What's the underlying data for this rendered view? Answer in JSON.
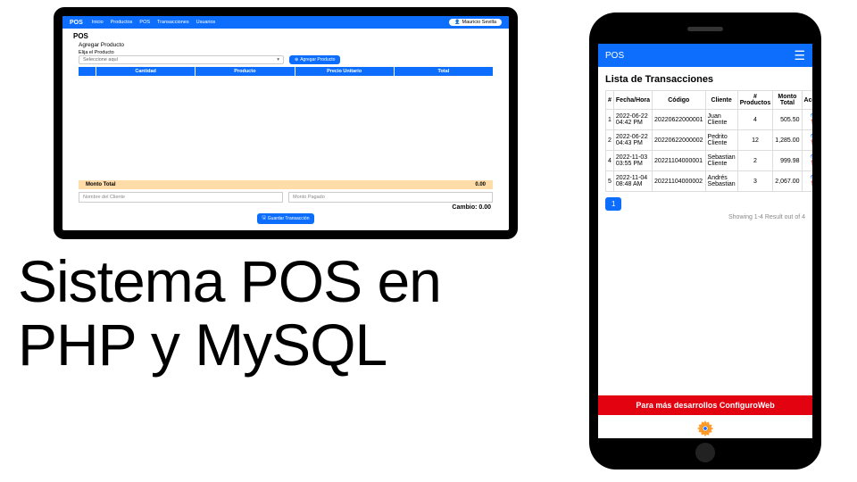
{
  "headline_line1": "Sistema POS en",
  "headline_line2": "PHP y MySQL",
  "laptop": {
    "brand": "POS",
    "nav": [
      "Inicio",
      "Productos",
      "POS",
      "Transacciones",
      "Usuarios"
    ],
    "user": "Mauricio Sevilla",
    "page_title": "POS",
    "section": "Agregar Producto",
    "select_label": "Elija el Producto",
    "select_placeholder": "Seleccione aquí",
    "btn_add": "Agregar Producto",
    "thead": [
      "",
      "Cantidad",
      "Producto",
      "Precio Unitario",
      "Total"
    ],
    "total_label": "Monto Total",
    "total_value": "0.00",
    "input_name": "Nombre del Cliente",
    "input_paid": "Monto Pagado",
    "change_label": "Cambio:",
    "change_value": "0.00",
    "btn_save": "Guardar Transacción"
  },
  "phone": {
    "brand": "POS",
    "title": "Lista de Transacciones",
    "thead": [
      "#",
      "Fecha/Hora",
      "Código",
      "Cliente",
      "# Productos",
      "Monto Total",
      "Acción"
    ],
    "rows": [
      {
        "n": "1",
        "dt": "2022-06-22 04:42 PM",
        "code": "20220622000001",
        "client": "Juan Cliente",
        "qty": "4",
        "total": "505.50"
      },
      {
        "n": "2",
        "dt": "2022-06-22 04:43 PM",
        "code": "20220622000002",
        "client": "Pedrito Cliente",
        "qty": "12",
        "total": "1,285.00"
      },
      {
        "n": "4",
        "dt": "2022-11-03 03:55 PM",
        "code": "20221104000001",
        "client": "Sebastian Cliente",
        "qty": "2",
        "total": "999.98"
      },
      {
        "n": "5",
        "dt": "2022-11-04 08:48 AM",
        "code": "20221104000002",
        "client": "Andrés Sebastian",
        "qty": "3",
        "total": "2,067.00"
      }
    ],
    "page": "1",
    "showing": "Showing 1-4 Result out of 4",
    "footer": "Para más desarrollos ConfiguroWeb"
  }
}
